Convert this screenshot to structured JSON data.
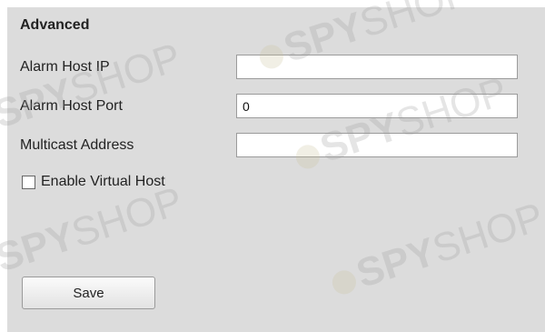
{
  "advanced": {
    "title": "Advanced",
    "fields": [
      {
        "label": "Alarm Host IP",
        "value": ""
      },
      {
        "label": "Alarm Host Port",
        "value": "0"
      },
      {
        "label": "Multicast Address",
        "value": ""
      }
    ],
    "enable_virtual_host": {
      "label": "Enable Virtual Host",
      "checked": false
    },
    "save_label": "Save"
  },
  "watermark": {
    "brand_bold": "SPY",
    "brand_light": "SHOP"
  }
}
